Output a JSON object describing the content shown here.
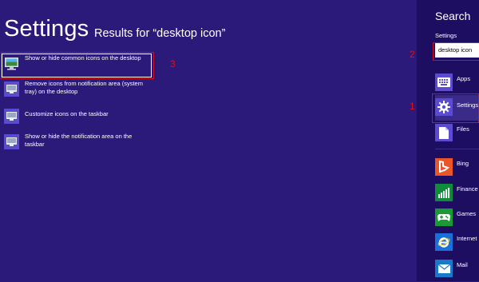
{
  "page": {
    "title": "Settings",
    "subtitle": "Results for “desktop icon”"
  },
  "results": [
    {
      "label": "Show or hide common icons on the desktop",
      "icon": "display-settings-icon",
      "selected": true
    },
    {
      "label": "Remove icons from notification area (system tray) on the desktop",
      "icon": "monitor-icon",
      "selected": false
    },
    {
      "label": "Customize icons on the taskbar",
      "icon": "monitor-icon",
      "selected": false
    },
    {
      "label": "Show or hide the notification area on the taskbar",
      "icon": "monitor-icon",
      "selected": false
    }
  ],
  "annotations": {
    "one": "1",
    "two": "2",
    "three": "3"
  },
  "charm": {
    "title": "Search",
    "scope_label": "Settings",
    "search_value": "desktop icon",
    "categories": [
      {
        "label": "Apps",
        "icon": "keyboard-icon",
        "color": "#5b4bd0"
      },
      {
        "label": "Settings",
        "icon": "gear-icon",
        "color": "#5b4bd0"
      },
      {
        "label": "Files",
        "icon": "file-icon",
        "color": "#5b4bd0"
      },
      {
        "label": "Bing",
        "icon": "bing-icon",
        "color": "#e8562a"
      },
      {
        "label": "Finance",
        "icon": "chart-icon",
        "color": "#128a3c"
      },
      {
        "label": "Games",
        "icon": "gamepad-icon",
        "color": "#1a9a36"
      },
      {
        "label": "Internet Explorer",
        "icon": "ie-icon",
        "color": "#1a6fd8"
      },
      {
        "label": "Mail",
        "icon": "mail-icon",
        "color": "#1a78c8"
      }
    ]
  },
  "colors": {
    "background": "#2b1a7a",
    "charm": "#1d0e62",
    "highlight": "#d0101e"
  }
}
